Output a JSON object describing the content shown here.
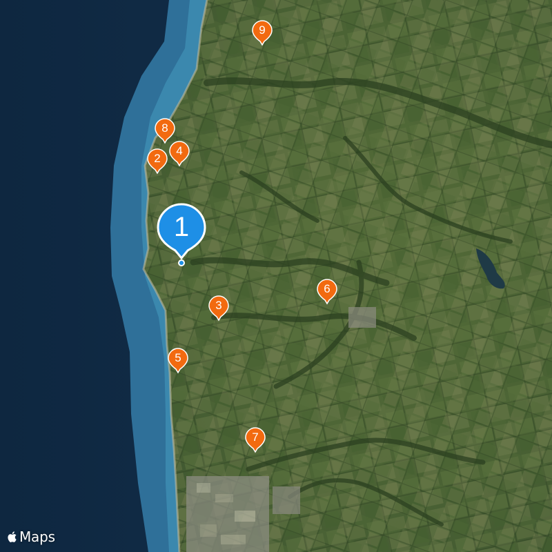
{
  "map": {
    "type": "satellite",
    "colors": {
      "ocean_deep": "#0f2a45",
      "ocean_shallow": "#3b7ea6",
      "land": "#4a6234",
      "selected_pin": "#1e8fe6",
      "pin": "#f26a10"
    }
  },
  "markers": [
    {
      "label": "1",
      "selected": true
    },
    {
      "label": "2"
    },
    {
      "label": "3"
    },
    {
      "label": "4"
    },
    {
      "label": "5"
    },
    {
      "label": "6"
    },
    {
      "label": "7"
    },
    {
      "label": "8"
    },
    {
      "label": "9"
    }
  ],
  "current_location": {
    "icon": "location-dot-icon"
  },
  "attribution": {
    "text": "Maps",
    "icon": "apple-logo-icon"
  }
}
